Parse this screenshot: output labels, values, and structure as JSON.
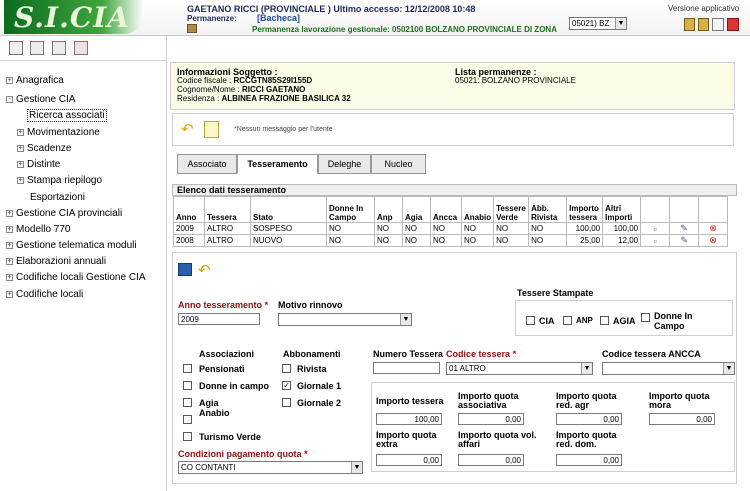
{
  "app": {
    "logo_text": "S.I.CIA",
    "user_line": "GAETANO RICCI (PROVINCIALE ) Ultimo accesso: 12/12/2008 10:48",
    "permanenze_label": "Permanenze:",
    "bacheca": "[Bacheca]",
    "permanenza_line": "Permanenza lavorazione gestionale: 0502100 BOLZANO PROVINCIALE DI ZONA",
    "office_select": "05021) BZ",
    "version": "Versione applicativo"
  },
  "sidebar": {
    "items": [
      {
        "label": "Anagrafica",
        "sign": "+"
      },
      {
        "label": "Gestione CIA",
        "sign": "-"
      },
      {
        "label": "Ricerca associati",
        "sign": ""
      },
      {
        "label": "Movimentazione",
        "sign": "+"
      },
      {
        "label": "Scadenze",
        "sign": "+"
      },
      {
        "label": "Distinte",
        "sign": "+"
      },
      {
        "label": "Stampa riepilogo",
        "sign": "+"
      },
      {
        "label": "Esportazioni",
        "sign": ""
      },
      {
        "label": "Gestione CIA provinciali",
        "sign": "+"
      },
      {
        "label": "Modello 770",
        "sign": "+"
      },
      {
        "label": "Gestione telematica moduli",
        "sign": "+"
      },
      {
        "label": "Elaborazioni annuali",
        "sign": "+"
      },
      {
        "label": "Codifiche locali Gestione CIA",
        "sign": "+"
      },
      {
        "label": "Codifiche locali",
        "sign": "+"
      }
    ]
  },
  "info": {
    "title": "Informazioni Soggetto :",
    "cf_label": "Codice fiscale :",
    "cf": "RCCGTN85S29I155D",
    "nome_label": "Cognome/Nome :",
    "nome": "RICCI GAETANO",
    "res_label": "Residenza :",
    "res": "ALBINEA FRAZIONE BASILICA 32",
    "perm_title": "Lista permanenze :",
    "perm_value": "05021: BOLZANO PROVINCIALE"
  },
  "messages": {
    "text": "*Nessun messaggio per l'utente"
  },
  "tabs": [
    "Associato",
    "Tesseramento",
    "Deleghe",
    "Nucleo"
  ],
  "grid": {
    "title": "Elenco dati tesseramento",
    "headers": [
      "Anno",
      "Tessera",
      "Stato",
      "Donne In Campo",
      "Anp",
      "Agia",
      "Ancca",
      "Anabio",
      "Tessere Verde",
      "Abb. Rivista",
      "Importo tessera",
      "Altri Importi"
    ],
    "rows": [
      [
        "2009",
        "ALTRO",
        "SOSPESO",
        "NO",
        "NO",
        "NO",
        "NO",
        "NO",
        "NO",
        "NO",
        "100,00",
        "100,00"
      ],
      [
        "2008",
        "ALTRO",
        "NUOVO",
        "NO",
        "NO",
        "NO",
        "NO",
        "NO",
        "NO",
        "NO",
        "25,00",
        "12,00"
      ]
    ]
  },
  "form": {
    "anno_label": "Anno tesseramento",
    "anno_value": "2009",
    "motivo_label": "Motivo rinnovo",
    "motivo_value": "",
    "tessere_stampate_label": "Tessere Stampate",
    "stampate": [
      "CIA",
      "ANP",
      "AGIA",
      "Donne In Campo"
    ],
    "associazioni_label": "Associazioni",
    "associazioni": [
      "Pensionati",
      "Donne in campo",
      "Agia",
      "Anabio",
      "Turismo Verde"
    ],
    "abbonamenti_label": "Abbonamenti",
    "abbonamenti": [
      "Rivista",
      "Giornale 1",
      "Giornale 2"
    ],
    "numero_tessera_label": "Numero Tessera",
    "numero_tessera_value": "",
    "codice_tessera_label": "Codice tessera",
    "codice_tessera_value": "01 ALTRO",
    "codice_ancca_label": "Codice tessera ANCCA",
    "codice_ancca_value": "",
    "importo_tessera_label": "Importo tessera",
    "importo_tessera_value": "100,00",
    "quota_assoc_label": "Importo quota associativa",
    "quota_assoc_value": "0,00",
    "quota_agr_label": "Importo quota red. agr",
    "quota_agr_value": "0,00",
    "quota_mora_label": "Importo quota mora",
    "quota_mora_value": "0,00",
    "quota_extra_label": "Importo quota extra",
    "quota_extra_value": "0,00",
    "quota_vol_label": "Importo quota vol. affari",
    "quota_vol_value": "0,00",
    "quota_dom_label": "Importo quota red. dom.",
    "quota_dom_value": "0,00",
    "condizioni_label": "Condizioni pagamento quota",
    "condizioni_value": "CO CONTANTI",
    "required_mark": "*"
  }
}
